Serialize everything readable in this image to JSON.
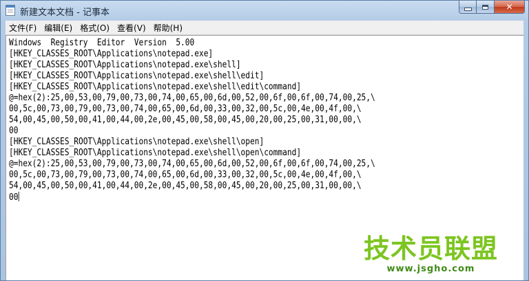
{
  "window": {
    "title": "新建文本文档 - 记事本"
  },
  "caption_buttons": {
    "close_glyph": "✕"
  },
  "menu": [
    {
      "label": "文件(F)"
    },
    {
      "label": "编辑(E)"
    },
    {
      "label": "格式(O)"
    },
    {
      "label": "查看(V)"
    },
    {
      "label": "帮助(H)"
    }
  ],
  "document": {
    "text": "Windows  Registry  Editor  Version  5.00\n[HKEY_CLASSES_ROOT\\Applications\\notepad.exe]\n[HKEY_CLASSES_ROOT\\Applications\\notepad.exe\\shell]\n[HKEY_CLASSES_ROOT\\Applications\\notepad.exe\\shell\\edit]\n[HKEY_CLASSES_ROOT\\Applications\\notepad.exe\\shell\\edit\\command]\n@=hex(2):25,00,53,00,79,00,73,00,74,00,65,00,6d,00,52,00,6f,00,6f,00,74,00,25,\\\n00,5c,00,73,00,79,00,73,00,74,00,65,00,6d,00,33,00,32,00,5c,00,4e,00,4f,00,\\\n54,00,45,00,50,00,41,00,44,00,2e,00,45,00,58,00,45,00,20,00,25,00,31,00,00,\\\n00\n[HKEY_CLASSES_ROOT\\Applications\\notepad.exe\\shell\\open]\n[HKEY_CLASSES_ROOT\\Applications\\notepad.exe\\shell\\open\\command]\n@=hex(2):25,00,53,00,79,00,73,00,74,00,65,00,6d,00,52,00,6f,00,6f,00,74,00,25,\\\n00,5c,00,73,00,79,00,73,00,74,00,65,00,6d,00,33,00,32,00,5c,00,4e,00,4f,00,\\\n54,00,45,00,50,00,41,00,44,00,2e,00,45,00,58,00,45,00,20,00,25,00,31,00,00,\\\n00"
  },
  "watermark": {
    "logo": "技术员联盟",
    "url": "www.jsgho.com"
  },
  "colors": {
    "watermark_green": "#7cc520",
    "close_red": "#c03a1c"
  }
}
